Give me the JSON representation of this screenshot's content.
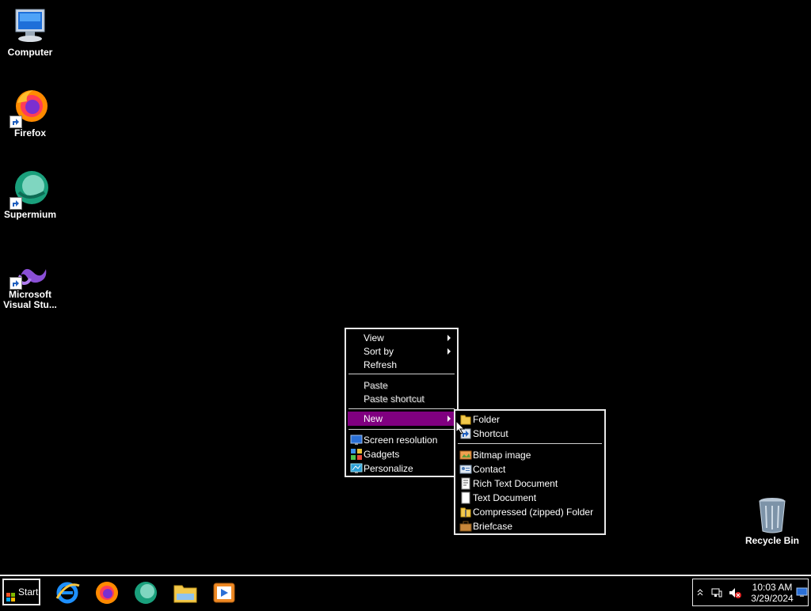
{
  "desktop": {
    "icons": [
      {
        "label": "Computer"
      },
      {
        "label": "Firefox"
      },
      {
        "label": "Supermium"
      },
      {
        "label_line1": "Microsoft",
        "label_line2": "Visual Stu..."
      },
      {
        "label": "Recycle Bin"
      }
    ]
  },
  "context_menu": {
    "items": [
      {
        "label": "View"
      },
      {
        "label": "Sort by"
      },
      {
        "label": "Refresh"
      },
      {
        "label": "Paste"
      },
      {
        "label": "Paste shortcut"
      },
      {
        "label": "New"
      },
      {
        "label": "Screen resolution"
      },
      {
        "label": "Gadgets"
      },
      {
        "label": "Personalize"
      }
    ]
  },
  "new_submenu": {
    "items": [
      {
        "label": "Folder"
      },
      {
        "label": "Shortcut"
      },
      {
        "label": "Bitmap image"
      },
      {
        "label": "Contact"
      },
      {
        "label": "Rich Text Document"
      },
      {
        "label": "Text Document"
      },
      {
        "label": "Compressed (zipped) Folder"
      },
      {
        "label": "Briefcase"
      }
    ]
  },
  "taskbar": {
    "start_label": "Start",
    "pinned": [
      "internet-explorer-icon",
      "firefox-icon",
      "supermium-icon",
      "file-explorer-icon",
      "media-player-icon"
    ],
    "clock": {
      "time": "10:03 AM",
      "date": "3/29/2024"
    }
  },
  "colors": {
    "highlight": "#800080",
    "desktop_bg": "#000000"
  }
}
